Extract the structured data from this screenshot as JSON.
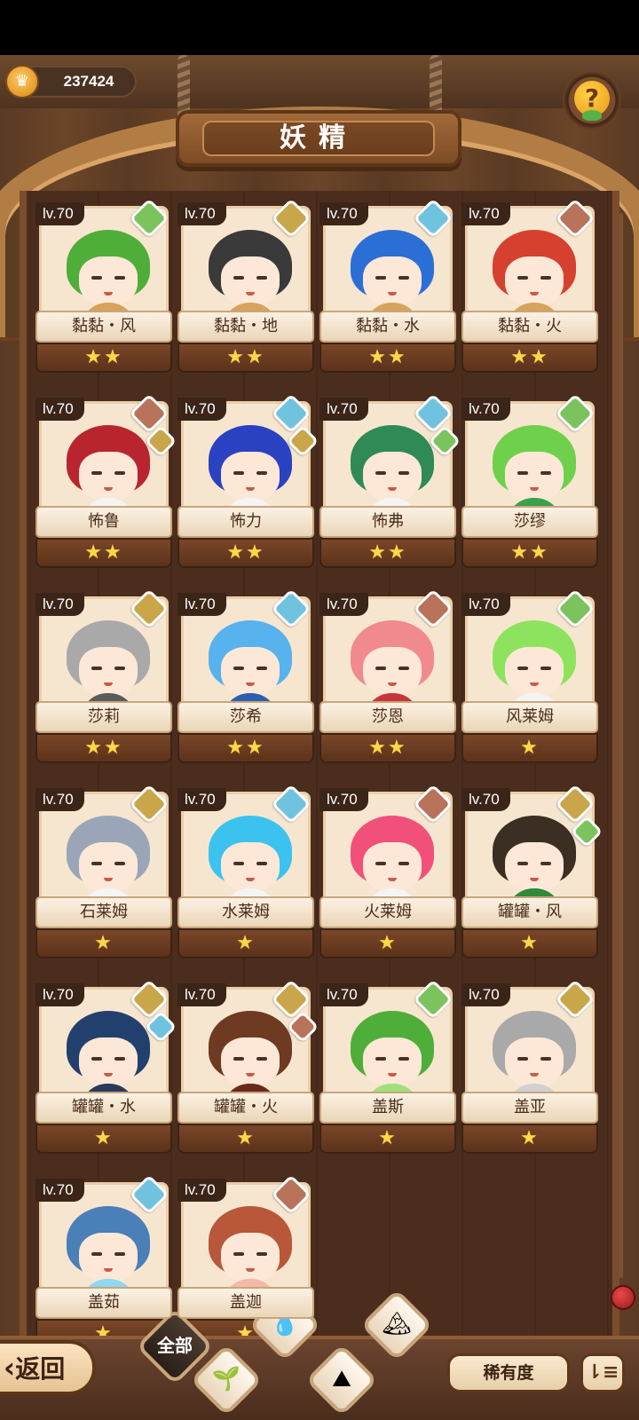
{
  "currency": {
    "icon": "crown-coin-icon",
    "value": "237424"
  },
  "help": {
    "icon": "question-sprout-icon",
    "glyph": "?"
  },
  "title": "妖精",
  "element_colors": {
    "grass": "#7cc35e",
    "earth": "#c9a64a",
    "water": "#6fc3df",
    "fire": "#b8735a"
  },
  "cards": [
    {
      "level": "lv.70",
      "name": "黏黏・风",
      "stars": 2,
      "elements": [
        "grass"
      ],
      "hair": "#4fae3a",
      "body": "#d6a35a"
    },
    {
      "level": "lv.70",
      "name": "黏黏・地",
      "stars": 2,
      "elements": [
        "earth"
      ],
      "hair": "#3a3a3a",
      "body": "#d6a35a"
    },
    {
      "level": "lv.70",
      "name": "黏黏・水",
      "stars": 2,
      "elements": [
        "water"
      ],
      "hair": "#2b6fd6",
      "body": "#d6a35a"
    },
    {
      "level": "lv.70",
      "name": "黏黏・火",
      "stars": 2,
      "elements": [
        "fire"
      ],
      "hair": "#d6402e",
      "body": "#d6a35a"
    },
    {
      "level": "lv.70",
      "name": "怖鲁",
      "stars": 2,
      "elements": [
        "fire",
        "earth"
      ],
      "hair": "#b8252e",
      "body": "#f4f4f4"
    },
    {
      "level": "lv.70",
      "name": "怖力",
      "stars": 2,
      "elements": [
        "water",
        "earth"
      ],
      "hair": "#2a42c2",
      "body": "#f4f4f4"
    },
    {
      "level": "lv.70",
      "name": "怖弗",
      "stars": 2,
      "elements": [
        "water",
        "grass"
      ],
      "hair": "#2f8a55",
      "body": "#f4f4f4"
    },
    {
      "level": "lv.70",
      "name": "莎缪",
      "stars": 2,
      "elements": [
        "grass"
      ],
      "hair": "#6fd04c",
      "body": "#3aa24a"
    },
    {
      "level": "lv.70",
      "name": "莎莉",
      "stars": 2,
      "elements": [
        "earth"
      ],
      "hair": "#a9a9a9",
      "body": "#5b5b5b"
    },
    {
      "level": "lv.70",
      "name": "莎希",
      "stars": 2,
      "elements": [
        "water"
      ],
      "hair": "#57b2ee",
      "body": "#2c5fb0"
    },
    {
      "level": "lv.70",
      "name": "莎恩",
      "stars": 2,
      "elements": [
        "fire"
      ],
      "hair": "#f08a8e",
      "body": "#c8343a"
    },
    {
      "level": "lv.70",
      "name": "风莱姆",
      "stars": 1,
      "elements": [
        "grass"
      ],
      "hair": "#8ee35e",
      "body": "#f4f4f4"
    },
    {
      "level": "lv.70",
      "name": "石莱姆",
      "stars": 1,
      "elements": [
        "earth"
      ],
      "hair": "#9aa6b8",
      "body": "#f4f4f4"
    },
    {
      "level": "lv.70",
      "name": "水莱姆",
      "stars": 1,
      "elements": [
        "water"
      ],
      "hair": "#3cc2ee",
      "body": "#f4f4f4"
    },
    {
      "level": "lv.70",
      "name": "火莱姆",
      "stars": 1,
      "elements": [
        "fire"
      ],
      "hair": "#f0507a",
      "body": "#f4f4f4"
    },
    {
      "level": "lv.70",
      "name": "罐罐・风",
      "stars": 1,
      "elements": [
        "earth",
        "grass"
      ],
      "hair": "#3b2e22",
      "body": "#2f8a3a"
    },
    {
      "level": "lv.70",
      "name": "罐罐・水",
      "stars": 1,
      "elements": [
        "earth",
        "water"
      ],
      "hair": "#22406e",
      "body": "#2a3a5a"
    },
    {
      "level": "lv.70",
      "name": "罐罐・火",
      "stars": 1,
      "elements": [
        "earth",
        "fire"
      ],
      "hair": "#6e3a22",
      "body": "#6a2a1a"
    },
    {
      "level": "lv.70",
      "name": "盖斯",
      "stars": 1,
      "elements": [
        "grass"
      ],
      "hair": "#4fae3a",
      "body": "#9ee07a"
    },
    {
      "level": "lv.70",
      "name": "盖亚",
      "stars": 1,
      "elements": [
        "earth"
      ],
      "hair": "#a9a9a9",
      "body": "#d0d0d0"
    },
    {
      "level": "lv.70",
      "name": "盖茹",
      "stars": 1,
      "elements": [
        "water"
      ],
      "hair": "#4a7fb8",
      "body": "#8fd8f4"
    },
    {
      "level": "lv.70",
      "name": "盖迦",
      "stars": 1,
      "elements": [
        "fire"
      ],
      "hair": "#b8573a",
      "body": "#f4b8a8"
    }
  ],
  "bottom": {
    "back_label": "返回",
    "back_icon": "chevron-left-icon",
    "filter_all_label": "全部",
    "filters": [
      {
        "name": "grass-filter",
        "glyph": "🌱"
      },
      {
        "name": "water-filter",
        "glyph": "💧"
      },
      {
        "name": "earth-filter",
        "glyph": "⛰"
      },
      {
        "name": "fire-filter",
        "glyph": "🏔"
      }
    ],
    "sort_label": "稀有度",
    "order_icon": "sort-order-icon",
    "order_glyph": "⇂≡"
  }
}
